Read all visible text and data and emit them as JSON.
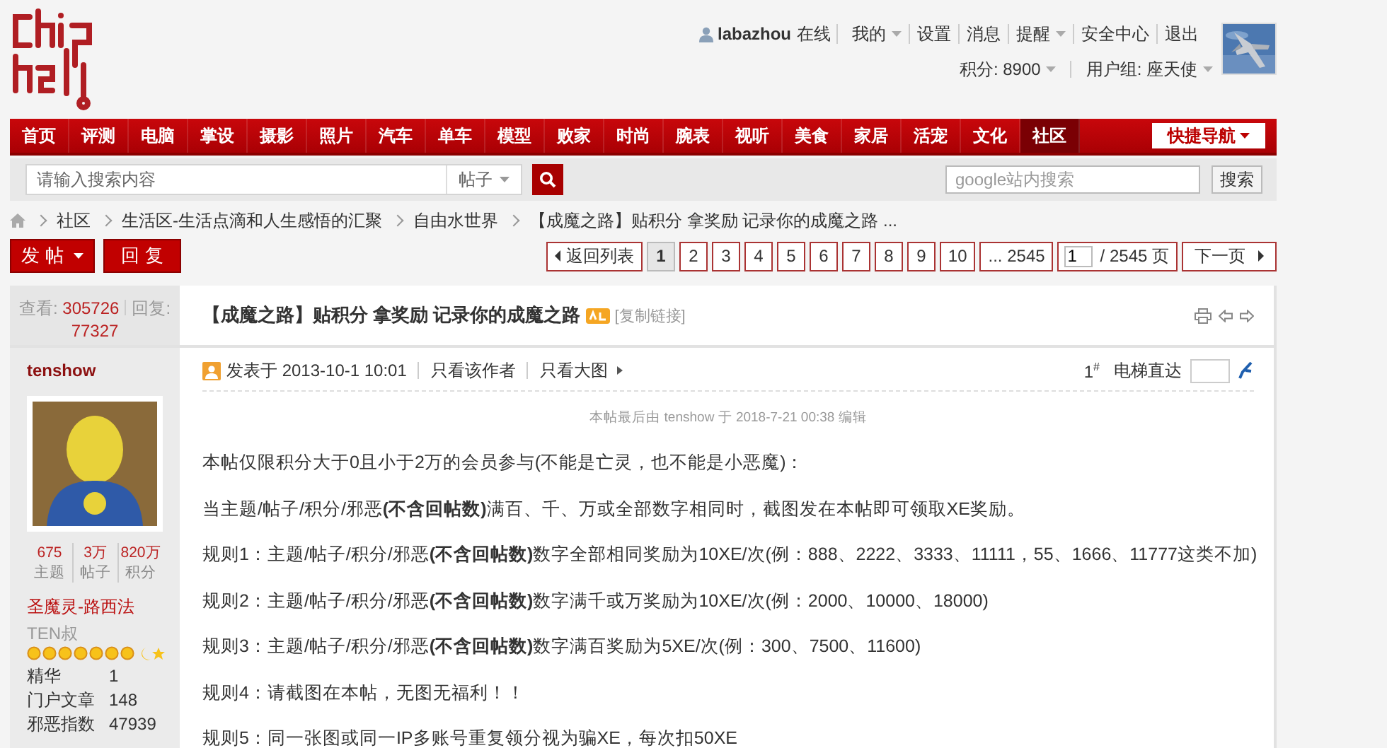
{
  "user": {
    "name": "labazhou",
    "status": "在线",
    "links": [
      {
        "label": "我的",
        "dropdown": true
      },
      {
        "label": "设置",
        "dropdown": false
      },
      {
        "label": "消息",
        "dropdown": false
      },
      {
        "label": "提醒",
        "dropdown": true
      },
      {
        "label": "安全中心",
        "dropdown": false
      },
      {
        "label": "退出",
        "dropdown": false
      }
    ],
    "points": "积分: 8900",
    "group": "用户组: 座天使"
  },
  "nav": {
    "items": [
      {
        "label": "首页",
        "selected": false
      },
      {
        "label": "评测",
        "selected": false
      },
      {
        "label": "电脑",
        "selected": false
      },
      {
        "label": "掌设",
        "selected": false
      },
      {
        "label": "摄影",
        "selected": false
      },
      {
        "label": "照片",
        "selected": false
      },
      {
        "label": "汽车",
        "selected": false
      },
      {
        "label": "单车",
        "selected": false
      },
      {
        "label": "模型",
        "selected": false
      },
      {
        "label": "败家",
        "selected": false
      },
      {
        "label": "时尚",
        "selected": false
      },
      {
        "label": "腕表",
        "selected": false
      },
      {
        "label": "视听",
        "selected": false
      },
      {
        "label": "美食",
        "selected": false
      },
      {
        "label": "家居",
        "selected": false
      },
      {
        "label": "活宠",
        "selected": false
      },
      {
        "label": "文化",
        "selected": false
      },
      {
        "label": "社区",
        "selected": true
      }
    ],
    "quick": "快捷导航"
  },
  "search": {
    "placeholder": "请输入搜索内容",
    "type": "帖子",
    "google_placeholder": "google站内搜索",
    "google_button": "搜索"
  },
  "breadcrumb": [
    "社区",
    "生活区-生活点滴和人生感悟的汇聚",
    "自由水世界",
    "【成魔之路】贴积分 拿奖励 记录你的成魔之路 ..."
  ],
  "actions": [
    {
      "label": "发 帖",
      "dropdown": true
    },
    {
      "label": "回 复",
      "dropdown": false
    }
  ],
  "pager": {
    "back": "返回列表",
    "pages": [
      {
        "label": "1",
        "selected": true
      },
      {
        "label": "2",
        "selected": false
      },
      {
        "label": "3",
        "selected": false
      },
      {
        "label": "4",
        "selected": false
      },
      {
        "label": "5",
        "selected": false
      },
      {
        "label": "6",
        "selected": false
      },
      {
        "label": "7",
        "selected": false
      },
      {
        "label": "8",
        "selected": false
      },
      {
        "label": "9",
        "selected": false
      },
      {
        "label": "10",
        "selected": false
      },
      {
        "label": "... 2545",
        "selected": false
      }
    ],
    "jump_value": "1",
    "total": "/ 2545 页",
    "next": "下一页"
  },
  "thread": {
    "views_label": "查看:",
    "views": "305726",
    "replies_label": "回复:",
    "replies": "77327",
    "title": "【成魔之路】贴积分 拿奖励 记录你的成魔之路",
    "copy_link": "[复制链接]"
  },
  "author": {
    "name": "tenshow",
    "stats": [
      {
        "value": "675",
        "label": "主题"
      },
      {
        "value": "3万",
        "label": "帖子"
      },
      {
        "value": "820万",
        "label": "积分"
      }
    ],
    "rank": "圣魔灵-路西法",
    "title": "TEN叔",
    "fields": [
      {
        "label": "精华",
        "value": "1"
      },
      {
        "label": "门户文章",
        "value": "148"
      },
      {
        "label": "邪恶指数",
        "value": "47939"
      }
    ]
  },
  "post": {
    "posted": "发表于 2013-10-1 10:01",
    "only_author": "只看该作者",
    "only_images": "只看大图",
    "floor": "1$^{#}$",
    "elevator": "电梯直达",
    "edit_note": "本帖最后由 tenshow 于 2018-7-21 00:38 编辑",
    "paragraphs": [
      "本帖仅限积分大于0且小于2万的会员参与(不能是亡灵，也不能是小恶魔)：",
      "当主题/帖子/积分/邪恶**(不含回帖数)**满百、千、万或全部数字相同时，截图发在本帖即可领取XE奖励。",
      "规则1：主题/帖子/积分/邪恶**(不含回帖数)**数字全部相同奖励为10XE/次(例：888、2222、3333、11111，55、1666、11777这类不加)",
      "规则2：主题/帖子/积分/邪恶**(不含回帖数)**数字满千或万奖励为10XE/次(例：2000、10000、18000)",
      "规则3：主题/帖子/积分/邪恶**(不含回帖数)**数字满百奖励为5XE/次(例：300、7500、11600)",
      "规则4：请截图在本帖，无图无福利！！",
      "规则5：同一张图或同一IP多账号重复领分视为骗XE，每次扣50XE"
    ]
  }
}
